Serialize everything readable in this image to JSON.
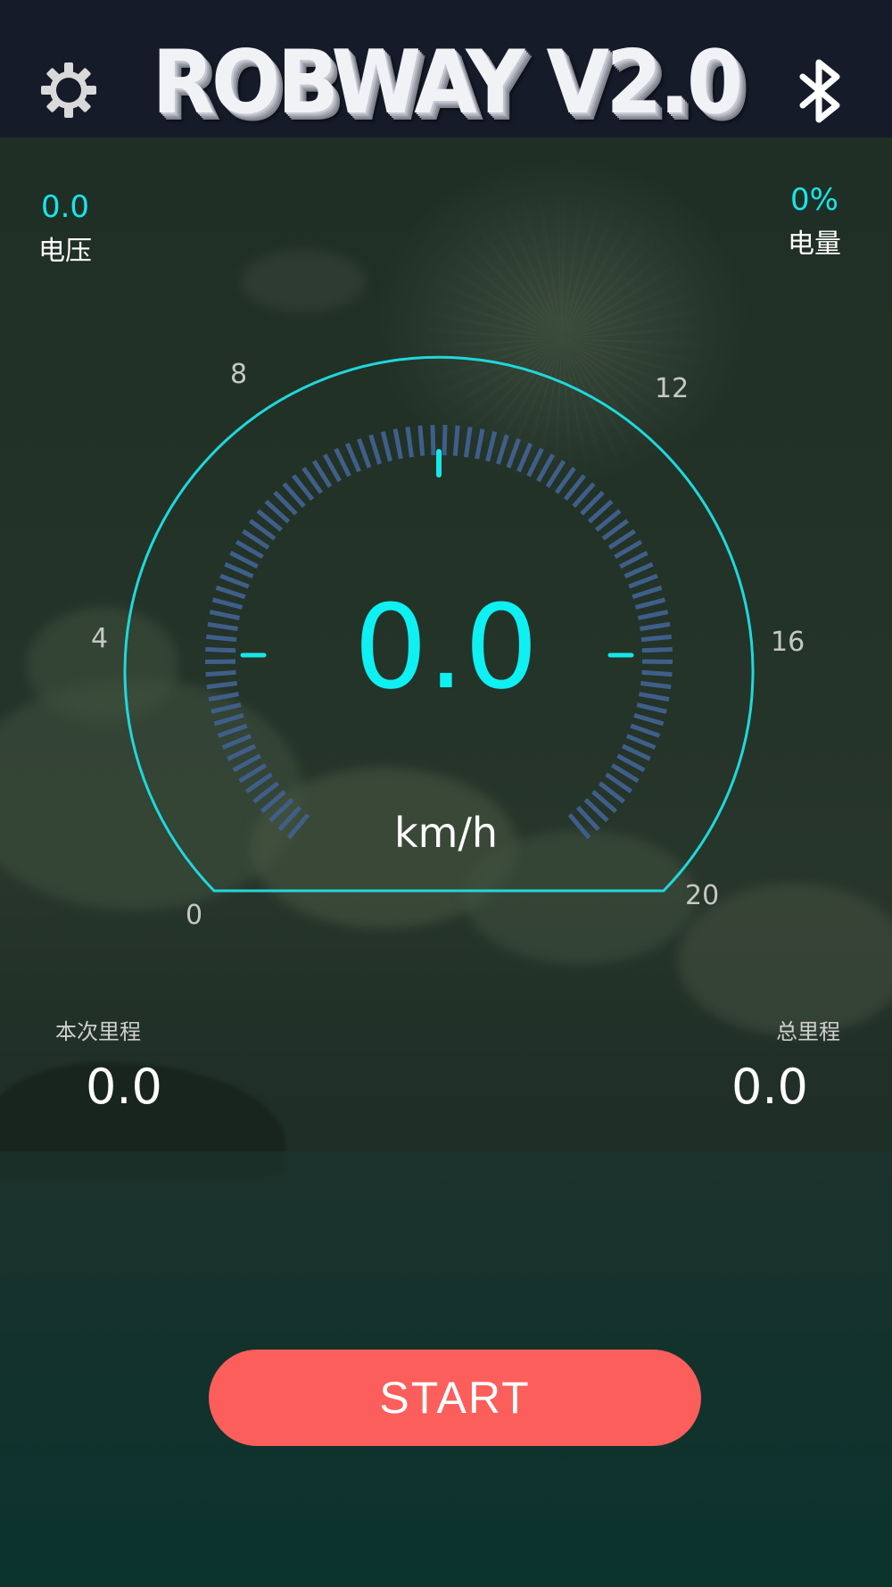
{
  "header": {
    "title": "ROBWAY V2.0",
    "settings_icon": "gear-icon",
    "bluetooth_icon": "bluetooth-icon",
    "background_color": "#151b29"
  },
  "voltage": {
    "value": "0.0",
    "label": "电压"
  },
  "battery": {
    "value": "0%",
    "label": "电量"
  },
  "speedometer": {
    "speed": "0.0",
    "unit": "km/h",
    "scale_labels": [
      "0",
      "4",
      "8",
      "12",
      "16",
      "20"
    ],
    "min": 0,
    "max": 20,
    "current_value": 0,
    "accent_color": "#17e6e8",
    "segment_color": "#3f5f8a"
  },
  "trip": {
    "label": "本次里程",
    "value": "0.0"
  },
  "total": {
    "label": "总里程",
    "value": "0.0"
  },
  "start_button": {
    "label": "START",
    "color": "#fb5e5b"
  }
}
